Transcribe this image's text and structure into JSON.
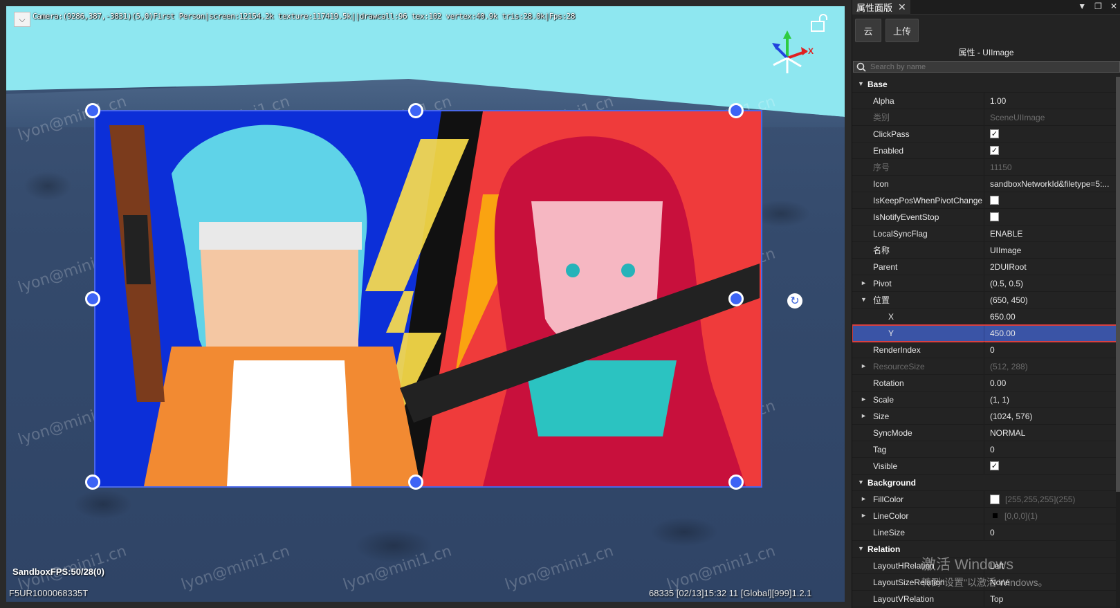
{
  "viewport": {
    "debug_info": "Camera:(9286,387,-3831)(5,0)First Person|screen:12154.2k texture:117419.5k||drawcall:96 tex:102 vertex:40.9k tris:28.0k|Fps:28",
    "hud_toggle_icon": "chevron-down-icon",
    "fps": "SandboxFPS:50/28(0)",
    "device_id": "F5UR1000068335T",
    "status_right": "68335    [02/13]15:32 11  [Global][999]1.2.1",
    "watermark": "lyon@mini1.cn",
    "gizmo_axis_x_label": "X",
    "colors": {
      "sky": "#8ee7f0",
      "selection": "#3d64f5",
      "vs_left": "#0c2fd8",
      "vs_right": "#ef3b3b"
    }
  },
  "panel": {
    "tab_label": "属性面版",
    "toolbar": {
      "cloud_label": "云",
      "upload_label": "上传"
    },
    "subtitle": "属性 - UIImage",
    "search_placeholder": "Search by name",
    "sections": {
      "base": "Base",
      "background": "Background",
      "relation": "Relation"
    },
    "props": {
      "alpha": {
        "key": "Alpha",
        "value": "1.00"
      },
      "category": {
        "key": "类别",
        "value": "SceneUIImage"
      },
      "clickpass": {
        "key": "ClickPass",
        "checked": true
      },
      "enabled": {
        "key": "Enabled",
        "checked": true
      },
      "index": {
        "key": "序号",
        "value": "11150"
      },
      "icon": {
        "key": "Icon",
        "value": "sandboxNetworkId&filetype=5:..."
      },
      "keeppos": {
        "key": "IsKeepPosWhenPivotChange",
        "checked": false
      },
      "notifystop": {
        "key": "IsNotifyEventStop",
        "checked": false
      },
      "localsync": {
        "key": "LocalSyncFlag",
        "value": "ENABLE"
      },
      "name": {
        "key": "名称",
        "value": "UIImage"
      },
      "parent": {
        "key": "Parent",
        "value": "2DUIRoot"
      },
      "pivot": {
        "key": "Pivot",
        "value": "(0.5, 0.5)"
      },
      "position": {
        "key": "位置",
        "value": "(650, 450)"
      },
      "pos_x": {
        "key": "X",
        "value": "650.00"
      },
      "pos_y": {
        "key": "Y",
        "value": "450.00"
      },
      "renderindex": {
        "key": "RenderIndex",
        "value": "0"
      },
      "resourcesize": {
        "key": "ResourceSize",
        "value": "(512, 288)"
      },
      "rotation": {
        "key": "Rotation",
        "value": "0.00"
      },
      "scale": {
        "key": "Scale",
        "value": "(1, 1)"
      },
      "size": {
        "key": "Size",
        "value": "(1024, 576)"
      },
      "syncmode": {
        "key": "SyncMode",
        "value": "NORMAL"
      },
      "tag": {
        "key": "Tag",
        "value": "0"
      },
      "visible": {
        "key": "Visible",
        "checked": true
      },
      "fillcolor": {
        "key": "FillColor",
        "value": "[255,255,255](255)",
        "swatch": "#ffffff"
      },
      "linecolor": {
        "key": "LineColor",
        "value": "[0,0,0](1)",
        "swatch": "#000000"
      },
      "linesize": {
        "key": "LineSize",
        "value": "0"
      },
      "hrelation": {
        "key": "LayoutHRelation",
        "value": "Left"
      },
      "sizerelation": {
        "key": "LayoutSizeRelation",
        "value": "None"
      },
      "vrelation": {
        "key": "LayoutVRelation",
        "value": "Top"
      }
    }
  },
  "os_overlay": {
    "line1": "激活 Windows",
    "line2": "转到\"设置\"以激活 Windows。"
  }
}
